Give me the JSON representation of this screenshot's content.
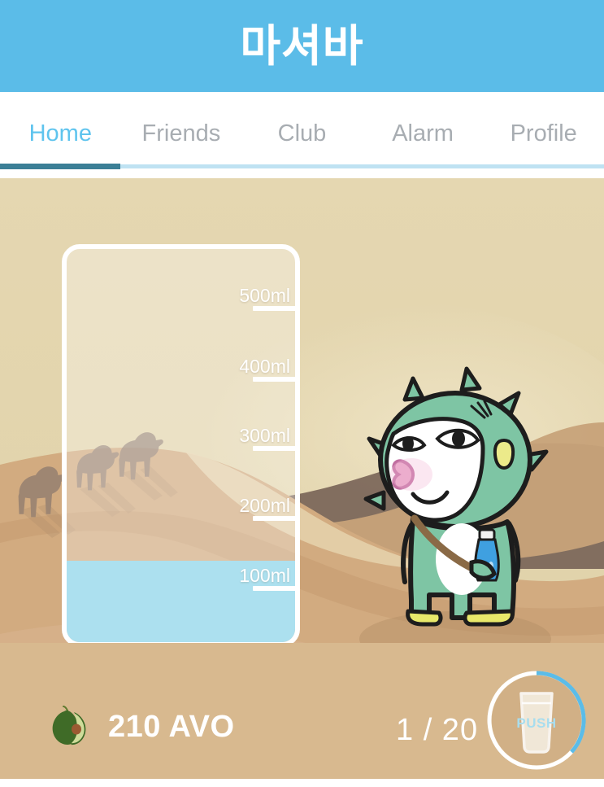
{
  "header": {
    "title": "마셔바",
    "bg_color": "#5bbce8"
  },
  "tabs": {
    "active_index": 0,
    "active_color": "#5fc4ee",
    "inactive_color": "#a8adb2",
    "indicator_color": "#3b7f96",
    "items": [
      {
        "label": "Home"
      },
      {
        "label": "Friends"
      },
      {
        "label": "Club"
      },
      {
        "label": "Alarm"
      },
      {
        "label": "Profile"
      }
    ]
  },
  "scene": {
    "sky_color": "#e3d5ae",
    "sand_color": "#d8b98f",
    "dune_shadow_color": "#7a6558",
    "camel_color": "#8d7a6e",
    "camel_count": 3
  },
  "bottle": {
    "water_color": "#ace0ef",
    "border_color": "#ffffff",
    "current_ml": 110,
    "capacity_ml": 500,
    "scale_marks": [
      {
        "label": "500ml",
        "value": 500
      },
      {
        "label": "400ml",
        "value": 400
      },
      {
        "label": "300ml",
        "value": 300
      },
      {
        "label": "200ml",
        "value": 200
      },
      {
        "label": "100ml",
        "value": 100
      }
    ]
  },
  "character": {
    "name": "green-dino-mascot",
    "body_color": "#7ec5a4",
    "face_color": "#ffffff",
    "cheek_color": "#f0a8c8",
    "spot_color": "#ecea8a",
    "bottle_color": "#3fa0e0",
    "strap_color": "#8a6a46",
    "shoe_color": "#e8e86a"
  },
  "bottom_bar": {
    "bg_color": "#d8b98f",
    "currency_icon": "avocado-icon",
    "currency_amount": "210 AVO",
    "glass_count": "1 / 20"
  },
  "push_button": {
    "label": "PUSH",
    "label_color": "#a8ddee",
    "ring_track_color": "#ffffff",
    "ring_progress_color": "#5bbce8",
    "progress_percent": 28
  }
}
